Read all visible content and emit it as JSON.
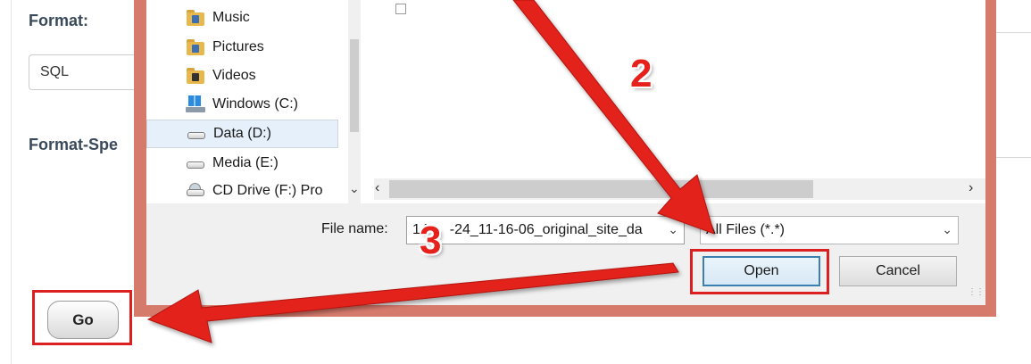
{
  "page": {
    "format_label": "Format:",
    "format_value": "SQL",
    "format_specific_label": "Format-Spe",
    "go_label": "Go"
  },
  "dialog": {
    "nav_items": [
      {
        "label": "Music",
        "icon": "music-folder-icon"
      },
      {
        "label": "Pictures",
        "icon": "pictures-folder-icon"
      },
      {
        "label": "Videos",
        "icon": "videos-folder-icon"
      },
      {
        "label": "Windows (C:)",
        "icon": "windows-drive-icon"
      },
      {
        "label": "Data (D:)",
        "icon": "drive-icon",
        "selected": true
      },
      {
        "label": "Media (E:)",
        "icon": "drive-icon"
      },
      {
        "label": "CD Drive (F:) Pro",
        "icon": "cd-drive-icon"
      }
    ],
    "file_name_label": "File name:",
    "file_name_value": "14",
    "file_name_value_rest": "-24_11-16-06_original_site_da",
    "file_type_value": "All Files (*.*)",
    "open_label": "Open",
    "cancel_label": "Cancel"
  },
  "annotations": {
    "step2": "2",
    "step3": "3"
  },
  "colors": {
    "highlight_red": "#dc1f1f",
    "dialog_border": "#d67a6c",
    "selected_item": "#e5f0fb"
  }
}
